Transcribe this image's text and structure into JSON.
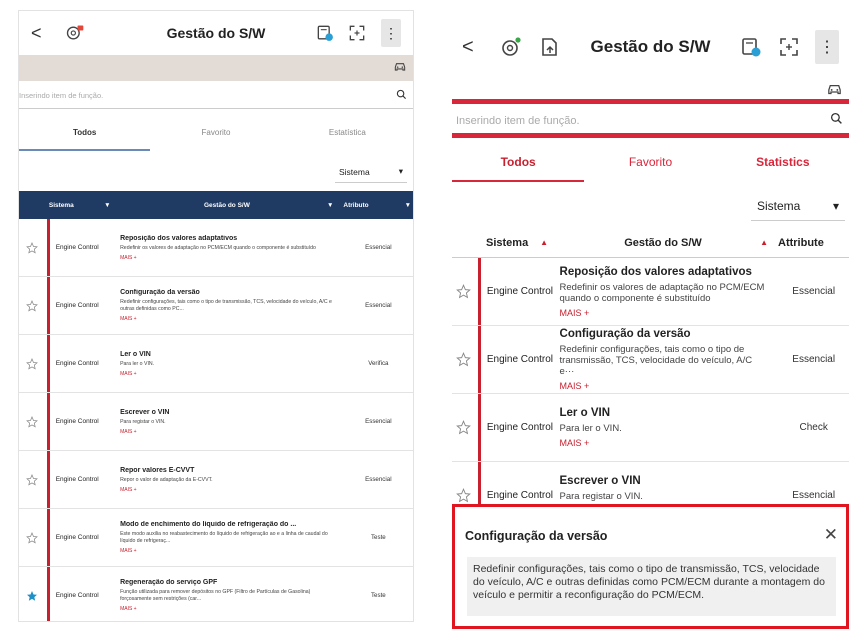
{
  "left": {
    "header": {
      "back": "<",
      "title": "Gestão do S/W",
      "kebab": "⋮"
    },
    "search": {
      "placeholder": "Inserindo item de função.",
      "icon": "search-icon"
    },
    "tabs": [
      "Todos",
      "Favorito",
      "Estatística"
    ],
    "filter": {
      "label": "Sistema",
      "arrow": "▾"
    },
    "columns": {
      "system": "Sistema",
      "function": "Gestão do S/W",
      "attribute": "Atributo"
    },
    "rows": [
      {
        "system": "Engine Control",
        "title": "Reposição dos valores adaptativos",
        "desc": "Redefinir os valores de adaptação no PCM/ECM quando o componente é substituído",
        "more": "MAIS +",
        "attribute": "Essencial",
        "favorite": false
      },
      {
        "system": "Engine Control",
        "title": "Configuração da versão",
        "desc": "Redefinir configurações, tais como o tipo de transmissão, TCS, velocidade do veículo, A/C e outras definidas como PC...",
        "more": "MAIS +",
        "attribute": "Essencial",
        "favorite": false
      },
      {
        "system": "Engine Control",
        "title": "Ler o VIN",
        "desc": "Para ler o VIN.",
        "more": "MAIS +",
        "attribute": "Verifica",
        "favorite": false
      },
      {
        "system": "Engine Control",
        "title": "Escrever o VIN",
        "desc": "Para registar o VIN.",
        "more": "MAIS +",
        "attribute": "Essencial",
        "favorite": false
      },
      {
        "system": "Engine Control",
        "title": "Repor valores E-CVVT",
        "desc": "Repor o valor de adaptação da E-CVVT.",
        "more": "MAIS +",
        "attribute": "Essencial",
        "favorite": false
      },
      {
        "system": "Engine Control",
        "title": "Modo de enchimento do líquido de refrigeração do ...",
        "desc": "Este modo auxilia no reabastecimento do líquido de refrigeração ao e a linha de caudal do líquido de refrigeraç...",
        "more": "MAIS +",
        "attribute": "Teste",
        "favorite": false
      },
      {
        "system": "Engine Control",
        "title": "Regeneração do serviço GPF",
        "desc": "Função utilizada para remover depósitos no GPF (Filtro de Partículas de Gasolina) forçosamente sem restrições (car...",
        "more": "MAIS +",
        "attribute": "Teste",
        "favorite": true
      }
    ]
  },
  "right": {
    "header": {
      "back": "<",
      "title": "Gestão do S/W",
      "kebab": "⋮"
    },
    "search": {
      "placeholder": "Inserindo item de função.",
      "icon": "search-icon"
    },
    "tabs": [
      "Todos",
      "Favorito",
      "Statistics"
    ],
    "filter": {
      "label": "Sistema",
      "arrow": "▾"
    },
    "columns": {
      "system": "Sistema",
      "function": "Gestão do S/W",
      "attribute": "Attribute"
    },
    "rows": [
      {
        "system": "Engine Control",
        "title": "Reposição dos valores adaptativos",
        "desc": "Redefinir os valores de adaptação no PCM/ECM quando o componente é substituído",
        "more": "MAIS +",
        "attribute": "Essencial"
      },
      {
        "system": "Engine Control",
        "title": "Configuração da versão",
        "desc": "Redefinir configurações, tais como o tipo de transmissão, TCS, velocidade do veículo, A/C e···",
        "more": "MAIS +",
        "attribute": "Essencial"
      },
      {
        "system": "Engine Control",
        "title": "Ler o VIN",
        "desc": "Para ler o VIN.",
        "more": "MAIS +",
        "attribute": "Check"
      },
      {
        "system": "Engine Control",
        "title": "Escrever o VIN",
        "desc": "Para registar o VIN.",
        "more": "MAIS +",
        "attribute": "Essencial"
      }
    ],
    "popup": {
      "title": "Configuração da versão",
      "close": "✕",
      "body": "Redefinir configurações, tais como o tipo de transmissão, TCS, velocidade do veículo, A/C e outras definidas como PCM/ECM durante a montagem do veículo e permitir a reconfiguração do PCM/ECM."
    }
  },
  "colors": {
    "accent_red": "#d8263a",
    "header_navy": "#1f3a63",
    "star_blue": "#1e90c8"
  }
}
